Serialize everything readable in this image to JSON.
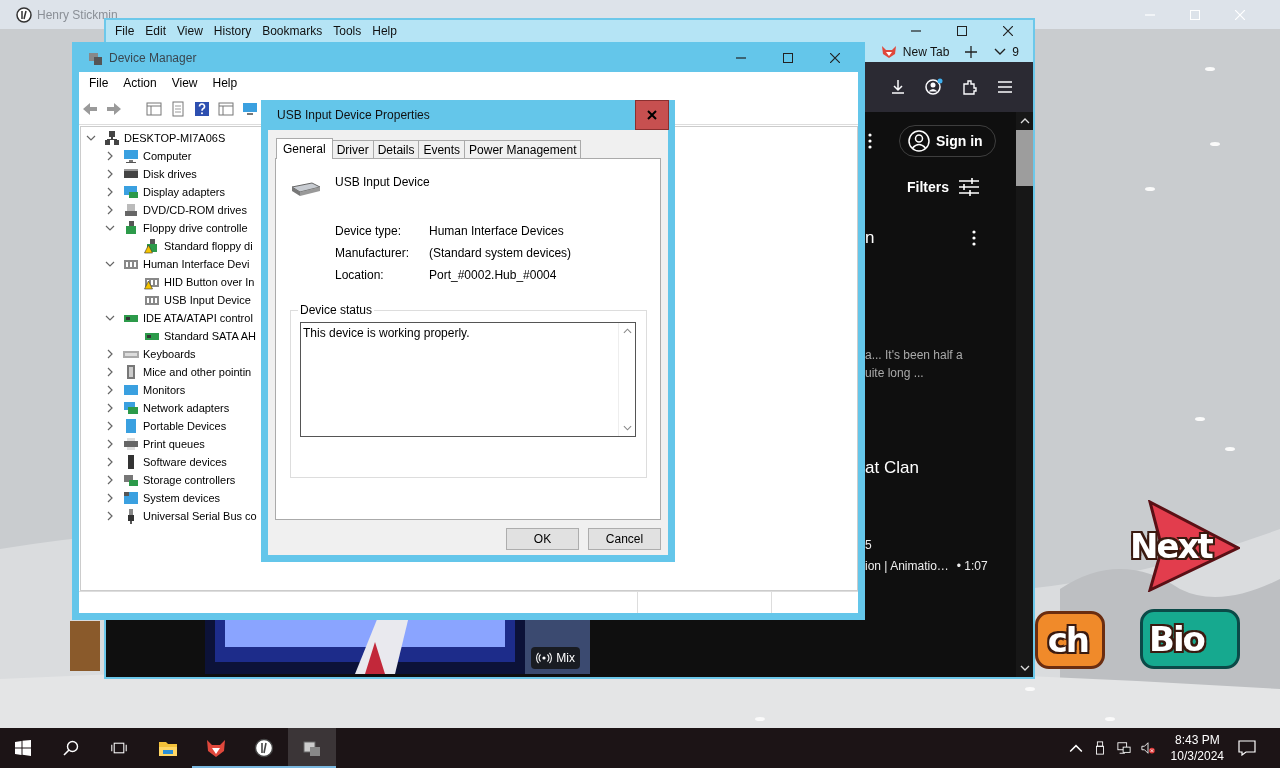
{
  "game": {
    "title": "Henry Stickmin",
    "buttons": [
      {
        "kind": "next",
        "label": "Next"
      },
      {
        "kind": "orange",
        "label": "ch"
      },
      {
        "kind": "teal",
        "label": "Bio"
      }
    ]
  },
  "browser": {
    "menu": [
      "File",
      "Edit",
      "View",
      "History",
      "Bookmarks",
      "Tools",
      "Help"
    ],
    "tab": "New Tab",
    "tab_count": "9",
    "sign_in": "Sign in",
    "filters": "Filters",
    "feed": [
      {
        "kind": "title",
        "text": "n",
        "menu": true
      },
      {
        "kind": "snippet",
        "text": "a... It's been half a"
      },
      {
        "kind": "snippet",
        "text": "uite long ..."
      },
      {
        "kind": "title",
        "text": "at Clan",
        "menu": false
      },
      {
        "kind": "meta",
        "text": "5"
      },
      {
        "kind": "meta",
        "text": "ion | Animatio…",
        "extra": "• 1:07"
      }
    ],
    "mix": "Mix"
  },
  "device_manager": {
    "title": "Device Manager",
    "menu": [
      "File",
      "Action",
      "View",
      "Help"
    ],
    "tree": {
      "label": "DESKTOP-MI7A06S",
      "kind": "desktop",
      "expanded": true,
      "children": [
        {
          "label": "Computer",
          "kind": "computer",
          "expanded": false
        },
        {
          "label": "Disk drives",
          "kind": "disk",
          "expanded": false
        },
        {
          "label": "Display adapters",
          "kind": "display",
          "expanded": false
        },
        {
          "label": "DVD/CD-ROM drives",
          "kind": "dvd",
          "expanded": false
        },
        {
          "label": "Floppy drive controlle",
          "kind": "floppy",
          "expanded": true,
          "children": [
            {
              "label": "Standard floppy di",
              "kind": "floppy",
              "warning": true
            }
          ]
        },
        {
          "label": "Human Interface Devi",
          "kind": "hid",
          "expanded": true,
          "children": [
            {
              "label": "HID Button over In",
              "kind": "hid",
              "warning": true
            },
            {
              "label": "USB Input Device",
              "kind": "hid",
              "warning": false
            }
          ]
        },
        {
          "label": "IDE ATA/ATAPI control",
          "kind": "ide",
          "expanded": true,
          "children": [
            {
              "label": "Standard SATA AH",
              "kind": "ide",
              "warning": false
            }
          ]
        },
        {
          "label": "Keyboards",
          "kind": "keyboard",
          "expanded": false
        },
        {
          "label": "Mice and other pointin",
          "kind": "mouse",
          "expanded": false
        },
        {
          "label": "Monitors",
          "kind": "monitor",
          "expanded": false
        },
        {
          "label": "Network adapters",
          "kind": "network",
          "expanded": false
        },
        {
          "label": "Portable Devices",
          "kind": "portable",
          "expanded": false
        },
        {
          "label": "Print queues",
          "kind": "printer",
          "expanded": false
        },
        {
          "label": "Software devices",
          "kind": "software",
          "expanded": false
        },
        {
          "label": "Storage controllers",
          "kind": "storage",
          "expanded": false
        },
        {
          "label": "System devices",
          "kind": "system",
          "expanded": false
        },
        {
          "label": "Universal Serial Bus co",
          "kind": "usb",
          "expanded": false
        }
      ]
    }
  },
  "dialog": {
    "title": "USB Input Device Properties",
    "tabs": [
      {
        "label": "General",
        "selected": true
      },
      {
        "label": "Driver",
        "selected": false
      },
      {
        "label": "Details",
        "selected": false
      },
      {
        "label": "Events",
        "selected": false
      },
      {
        "label": "Power Management",
        "selected": false
      }
    ],
    "device_name": "USB Input Device",
    "properties": [
      {
        "label": "Device type:",
        "value": "Human Interface Devices"
      },
      {
        "label": "Manufacturer:",
        "value": "(Standard system devices)"
      },
      {
        "label": "Location:",
        "value": "Port_#0002.Hub_#0004"
      }
    ],
    "status_group": "Device status",
    "status_text": "This device is working properly.",
    "buttons": [
      "OK",
      "Cancel"
    ]
  },
  "taskbar": {
    "apps": [
      {
        "kind": "folder",
        "running": false,
        "selected": false
      },
      {
        "kind": "fox",
        "running": true,
        "selected": false
      },
      {
        "kind": "stickmin",
        "running": true,
        "selected": false
      },
      {
        "kind": "devmgr",
        "running": true,
        "selected": true
      }
    ],
    "time": "8:43 PM",
    "date": "10/3/2024"
  }
}
